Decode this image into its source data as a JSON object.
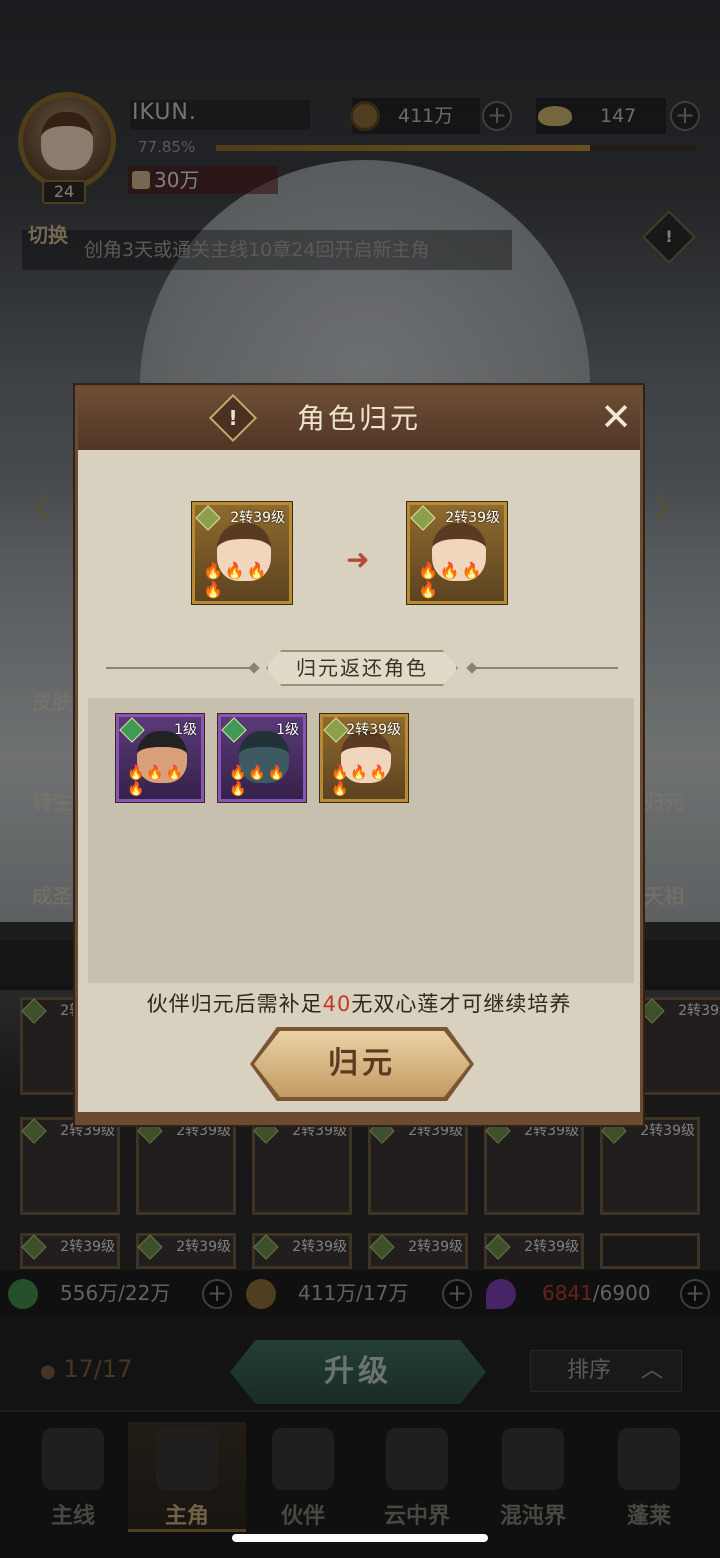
{
  "player": {
    "name": "IKUN.",
    "level": "24",
    "exp_percent": "77.85%",
    "exp_fraction": 0.7785,
    "power": "30万"
  },
  "currency": {
    "coins": "411万",
    "ingots": "147"
  },
  "switch_banner": {
    "badge": "切换",
    "text": "创角3天或通关主线10章24回开启新主角"
  },
  "side_menu": {
    "left": [
      "皮肤",
      "转生",
      "成圣"
    ],
    "right": [
      "归元",
      "天相"
    ]
  },
  "dialog": {
    "title": "角色归元",
    "source_hero": {
      "level": "2转39级",
      "drops": "🔥🔥🔥🔥"
    },
    "target_hero": {
      "level": "2转39级",
      "drops": "🔥🔥🔥🔥"
    },
    "arrow": "➜",
    "section_title": "归元返还角色",
    "returned": [
      {
        "level": "1级",
        "drops": "🔥🔥🔥🔥"
      },
      {
        "level": "1级",
        "drops": "🔥🔥🔥🔥"
      },
      {
        "level": "2转39级",
        "drops": "🔥🔥🔥🔥"
      }
    ],
    "notice_prefix": "伙伴归元后需补足",
    "notice_amount": "40",
    "notice_suffix": "无双心莲才可继续培养",
    "confirm_label": "归元",
    "close_glyph": "✕",
    "warn_glyph": "!"
  },
  "grid_cards": [
    {
      "level": "2转39级"
    },
    {
      "level": "2转39级"
    },
    {
      "level": "2转39级"
    },
    {
      "level": "2转39级"
    },
    {
      "level": "2转39级"
    },
    {
      "level": "2转39级"
    },
    {
      "level": "2转39级"
    },
    {
      "level": "2转39级"
    },
    {
      "level": "2转39级"
    },
    {
      "level": "2转39级"
    },
    {
      "level": "2转39级"
    },
    {
      "level": "2转39级"
    },
    {
      "level": "2转39级"
    }
  ],
  "resources": {
    "green": "556万/22万",
    "coin": "411万/17万",
    "purple_have": "6841",
    "purple_need": "/6900"
  },
  "bottom": {
    "slots": "17/17",
    "upgrade_label": "升级",
    "sort_label": "排序"
  },
  "nav": [
    {
      "label": "主线",
      "active": false
    },
    {
      "label": "主角",
      "active": true
    },
    {
      "label": "伙伴",
      "active": false
    },
    {
      "label": "云中界",
      "active": false
    },
    {
      "label": "混沌界",
      "active": false
    },
    {
      "label": "蓬莱",
      "active": false
    }
  ],
  "colors": {
    "accent_gold": "#b98a34",
    "dialog_bg": "#d9d1bf",
    "header_brown": "#6e4e35",
    "notice_red": "#c43a2a",
    "purple_rarity": "#8b53b8"
  }
}
